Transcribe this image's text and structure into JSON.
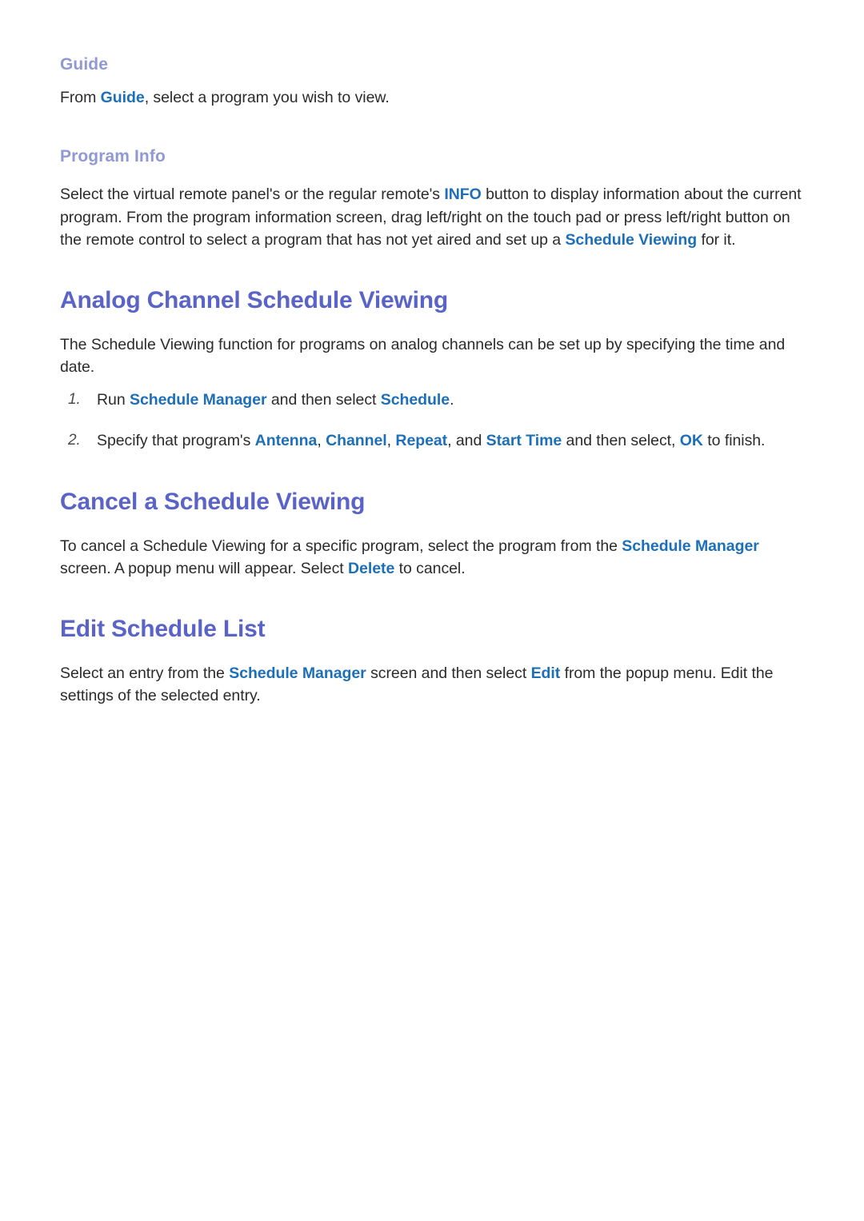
{
  "page": {
    "background_color": "#ffffff",
    "body_text_color": "#2b2b2b",
    "accent_heading_color": "#5a63c6",
    "accent_subheading_color": "#9199d2",
    "accent_link_color": "#1d6fb8"
  },
  "sections": {
    "guide": {
      "subheading": "Guide",
      "paragraph": {
        "part1": "From ",
        "ref1": "Guide",
        "part2": ", select a program you wish to view."
      }
    },
    "program_info": {
      "subheading": "Program Info",
      "paragraph": {
        "part1": "Select the virtual remote panel's or the regular remote's ",
        "ref1": "INFO",
        "part2": " button to display information about the current program. From the program information screen, drag left/right on the touch pad or press left/right button on the remote control to select a program that has not yet aired and set up a ",
        "ref2": "Schedule Viewing",
        "part3": " for it."
      }
    },
    "analog_channel": {
      "heading": "Analog Channel Schedule Viewing",
      "intro": "The Schedule Viewing function for programs on analog channels can be set up by specifying the time and date.",
      "steps": [
        {
          "number": "1.",
          "part1": "Run ",
          "ref1": "Schedule Manager",
          "part2": " and then select ",
          "ref2": "Schedule",
          "part3": "."
        },
        {
          "number": "2.",
          "part1": "Specify that program's ",
          "ref1": "Antenna",
          "part2": ", ",
          "ref2": "Channel",
          "part3": ", ",
          "ref3": "Repeat",
          "part4": ", and ",
          "ref4": "Start Time",
          "part5": " and then select, ",
          "ref5": "OK",
          "part6": " to finish."
        }
      ]
    },
    "cancel_schedule": {
      "heading": "Cancel a Schedule Viewing",
      "paragraph": {
        "part1": "To cancel a Schedule Viewing for a specific program, select the program from the ",
        "ref1": "Schedule Manager",
        "part2": " screen. A popup menu will appear. Select ",
        "ref2": "Delete",
        "part3": " to cancel."
      }
    },
    "edit_schedule_list": {
      "heading": "Edit Schedule List",
      "paragraph": {
        "part1": "Select an entry from the ",
        "ref1": "Schedule Manager",
        "part2": " screen and then select ",
        "ref2": "Edit",
        "part3": " from the popup menu. Edit the settings of the selected entry."
      }
    }
  }
}
